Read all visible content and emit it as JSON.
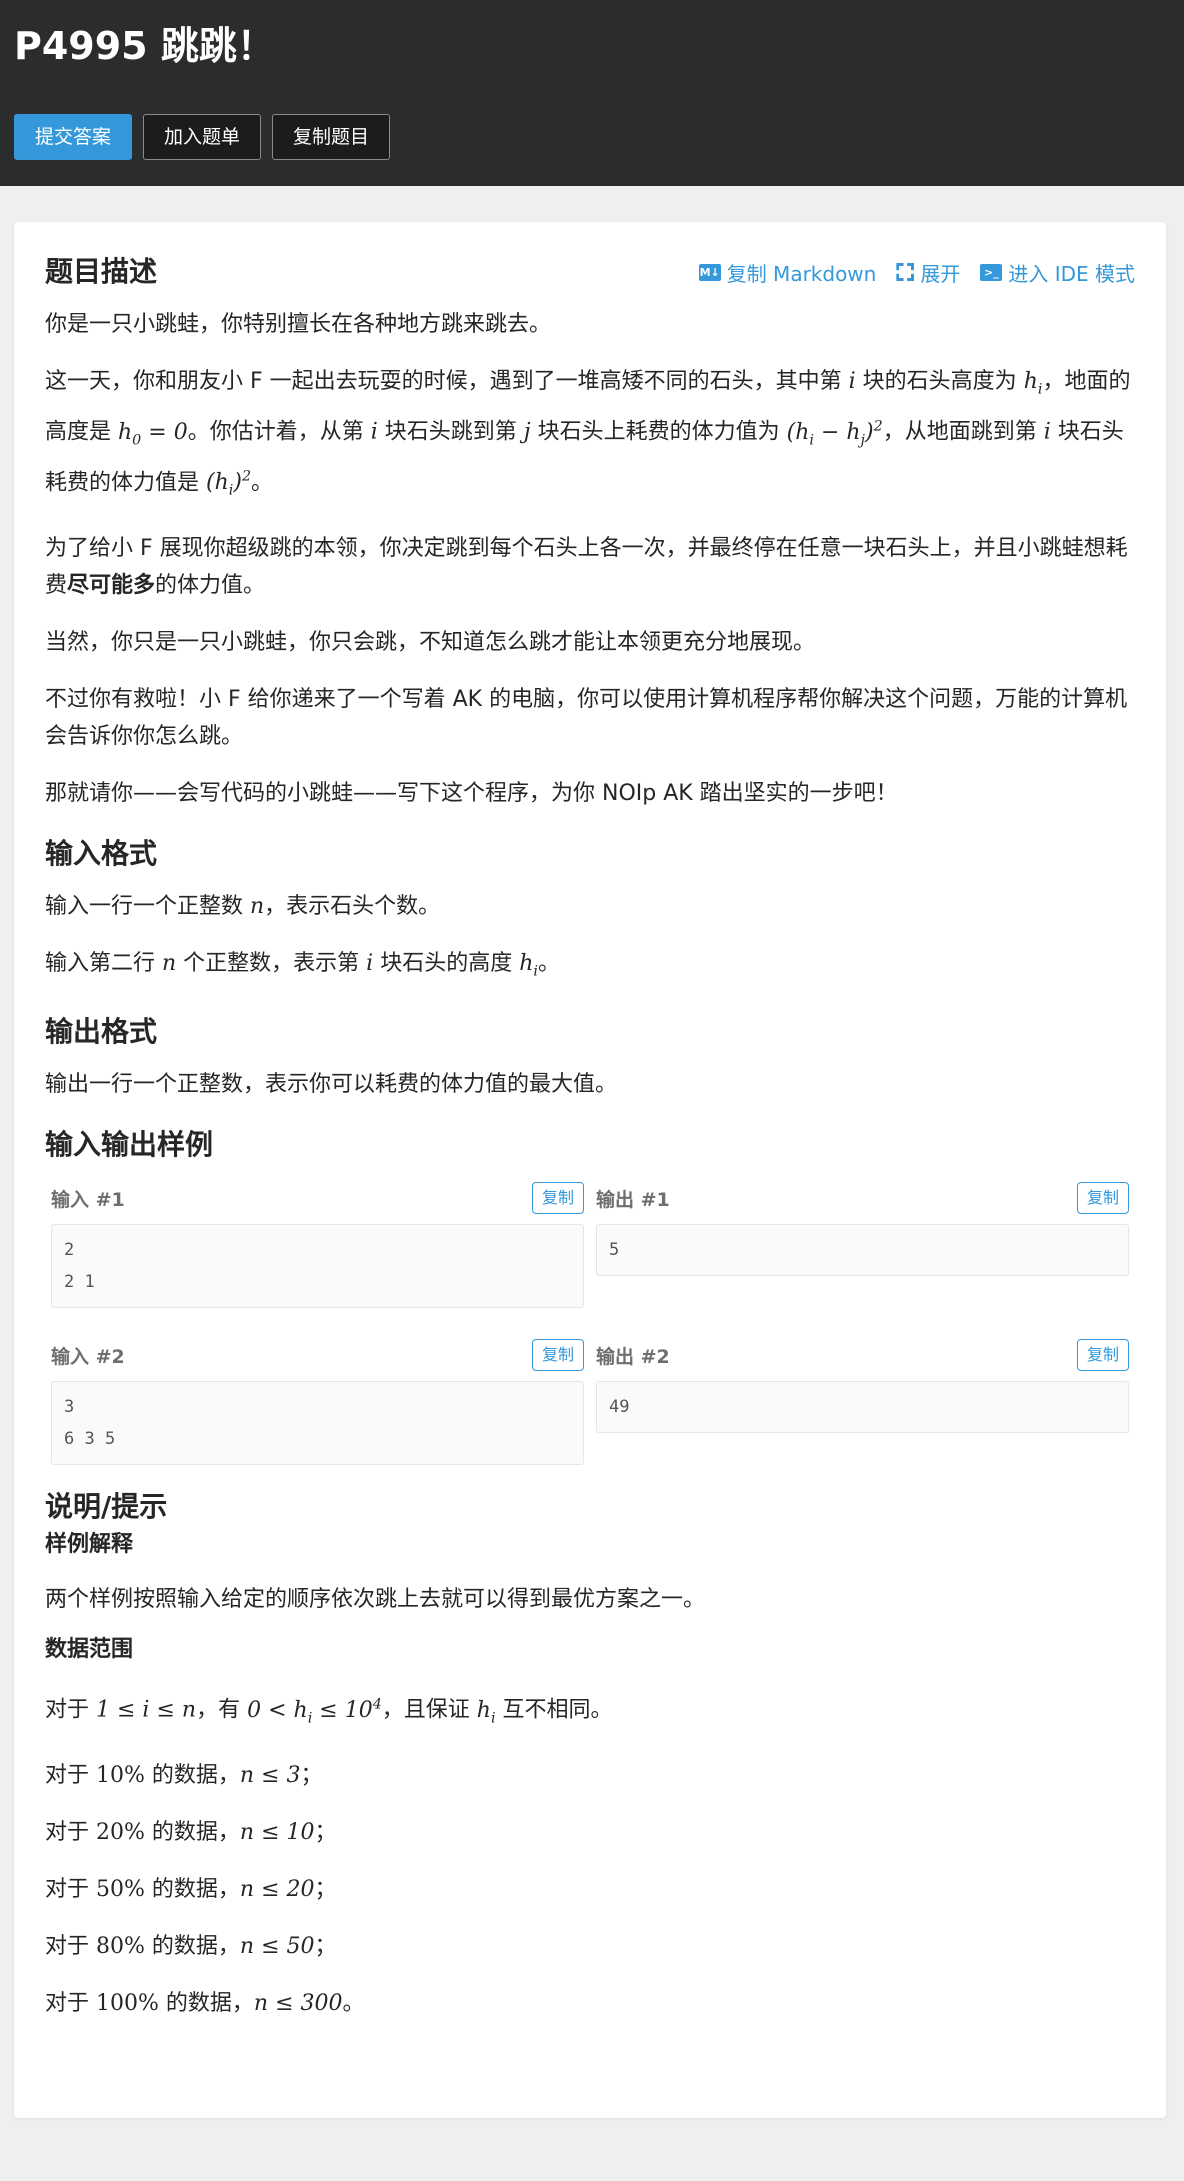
{
  "header": {
    "title": "P4995 跳跳！",
    "buttons": [
      "提交答案",
      "加入题单",
      "复制题目"
    ]
  },
  "card": {
    "section_title": "题目描述",
    "tools": {
      "copy_markdown": "复制 Markdown",
      "expand": "展开",
      "ide": "进入 IDE 模式"
    },
    "desc": {
      "p1": "你是一只小跳蛙，你特别擅长在各种地方跳来跳去。",
      "p2_a": "这一天，你和朋友小 F 一起出去玩耍的时候，遇到了一堆高矮不同的石头，其中第 ",
      "p2_b": " 块的石头高度为 ",
      "p2_c": "，地面的高度是 ",
      "p2_d": "。你估计着，从第 ",
      "p2_e": " 块石头跳到第 ",
      "p2_f": " 块石头上耗费的体力值为 ",
      "p2_g": "，从地面跳到第 ",
      "p2_h": " 块石头耗费的体力值是 ",
      "p2_i": "。",
      "p3_a": "为了给小 F 展现你超级跳的本领，你决定跳到每个石头上各一次，并最终停在任意一块石头上，并且小跳蛙想耗费",
      "p3_bold": "尽可能多",
      "p3_b": "的体力值。",
      "p4": "当然，你只是一只小跳蛙，你只会跳，不知道怎么跳才能让本领更充分地展现。",
      "p5": "不过你有救啦！小 F 给你递来了一个写着 AK 的电脑，你可以使用计算机程序帮你解决这个问题，万能的计算机会告诉你你怎么跳。",
      "p6": "那就请你——会写代码的小跳蛙——写下这个程序，为你 NOIp AK 踏出坚实的一步吧！"
    },
    "input_title": "输入格式",
    "input": {
      "l1_a": "输入一行一个正整数 ",
      "l1_b": "，表示石头个数。",
      "l2_a": "输入第二行 ",
      "l2_b": " 个正整数，表示第 ",
      "l2_c": " 块石头的高度 ",
      "l2_d": "。"
    },
    "output_title": "输出格式",
    "output": {
      "l1": "输出一行一个正整数，表示你可以耗费的体力值的最大值。"
    },
    "samples_title": "输入输出样例",
    "copy_label": "复制",
    "samples": [
      {
        "in_label": "输入 #1",
        "in_lines": [
          "2",
          "2 1"
        ],
        "out_label": "输出 #1",
        "out_lines": [
          "5"
        ]
      },
      {
        "in_label": "输入 #2",
        "in_lines": [
          "3",
          "6 3 5"
        ],
        "out_label": "输出 #2",
        "out_lines": [
          "49"
        ]
      }
    ],
    "hint_title": "说明/提示",
    "hint": {
      "sub1": "样例解释",
      "sub1_text": "两个样例按照输入给定的顺序依次跳上去就可以得到最优方案之一。",
      "sub2": "数据范围",
      "r1_a": "对于 ",
      "r1_b": "，有 ",
      "r1_c": "，且保证 ",
      "r1_d": " 互不相同。",
      "ranges": [
        {
          "pct": "10%",
          "cond": "n ≤ 3"
        },
        {
          "pct": "20%",
          "cond": "n ≤ 10"
        },
        {
          "pct": "50%",
          "cond": "n ≤ 20"
        },
        {
          "pct": "80%",
          "cond": "n ≤ 50"
        },
        {
          "pct": "100%",
          "cond": "n ≤ 300"
        }
      ],
      "range_prefix": "对于 ",
      "range_mid": " 的数据，",
      "range_end_semi": "；",
      "range_end_dot": "。"
    }
  }
}
